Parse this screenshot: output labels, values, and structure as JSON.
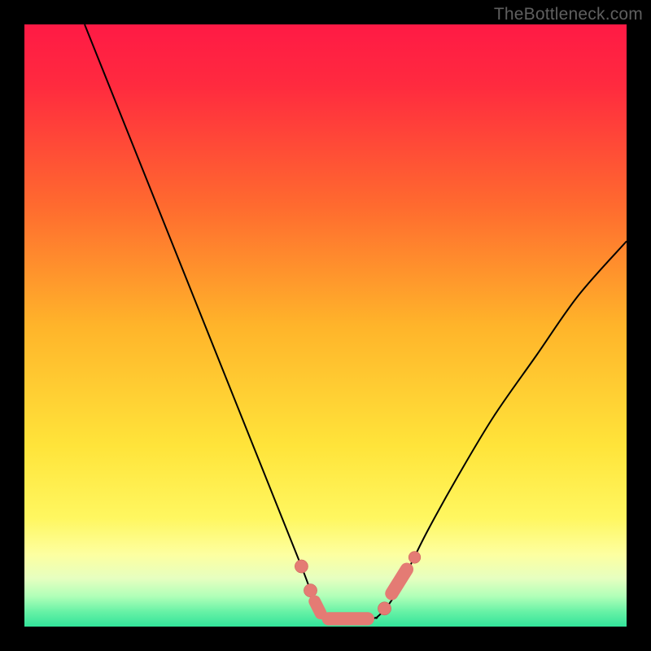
{
  "watermark": "TheBottleneck.com",
  "colors": {
    "background": "#000000",
    "gradient_stops": [
      {
        "pos": 0.0,
        "color": "#ff1a45"
      },
      {
        "pos": 0.1,
        "color": "#ff2a3f"
      },
      {
        "pos": 0.3,
        "color": "#ff6a2f"
      },
      {
        "pos": 0.5,
        "color": "#ffb42a"
      },
      {
        "pos": 0.7,
        "color": "#ffe43a"
      },
      {
        "pos": 0.82,
        "color": "#fff760"
      },
      {
        "pos": 0.88,
        "color": "#fdffa0"
      },
      {
        "pos": 0.92,
        "color": "#e6ffc0"
      },
      {
        "pos": 0.95,
        "color": "#b0ffb8"
      },
      {
        "pos": 0.975,
        "color": "#68f2a6"
      },
      {
        "pos": 1.0,
        "color": "#32e39a"
      }
    ],
    "curve": "#000000",
    "marker_fill": "#e47b74",
    "marker_stroke": "#c95a54"
  },
  "chart_data": {
    "type": "line",
    "title": "",
    "xlabel": "",
    "ylabel": "",
    "xlim": [
      0,
      100
    ],
    "ylim": [
      0,
      100
    ],
    "series": [
      {
        "name": "left-branch",
        "x": [
          10,
          14,
          18,
          22,
          26,
          30,
          34,
          38,
          42,
          44,
          46,
          47.5,
          48.5,
          49.5
        ],
        "y": [
          100,
          90,
          80,
          70,
          60,
          50,
          40,
          30,
          20,
          15,
          10,
          6,
          3,
          1.5
        ]
      },
      {
        "name": "right-branch",
        "x": [
          58.5,
          60,
          62,
          64,
          67,
          72,
          78,
          85,
          92,
          100
        ],
        "y": [
          1.5,
          3,
          6,
          10,
          16,
          25,
          35,
          45,
          55,
          64
        ]
      },
      {
        "name": "flat-bottom",
        "x": [
          49.5,
          51,
          53,
          55,
          57,
          58.5
        ],
        "y": [
          1.5,
          1.2,
          1.1,
          1.1,
          1.2,
          1.5
        ]
      }
    ],
    "markers": [
      {
        "shape": "circle",
        "x": 46.0,
        "y": 10.0,
        "r": 1.1
      },
      {
        "shape": "circle",
        "x": 47.5,
        "y": 6.0,
        "r": 1.1
      },
      {
        "shape": "capsule",
        "x1": 48.2,
        "y1": 4.2,
        "x2": 49.2,
        "y2": 2.2,
        "r": 1.0
      },
      {
        "shape": "capsule",
        "x1": 50.5,
        "y1": 1.3,
        "x2": 57.0,
        "y2": 1.3,
        "r": 1.1
      },
      {
        "shape": "circle",
        "x": 59.8,
        "y": 3.0,
        "r": 1.1
      },
      {
        "shape": "capsule",
        "x1": 61.0,
        "y1": 5.5,
        "x2": 63.5,
        "y2": 9.5,
        "r": 1.1
      },
      {
        "shape": "circle",
        "x": 64.8,
        "y": 11.5,
        "r": 1.0
      }
    ]
  }
}
